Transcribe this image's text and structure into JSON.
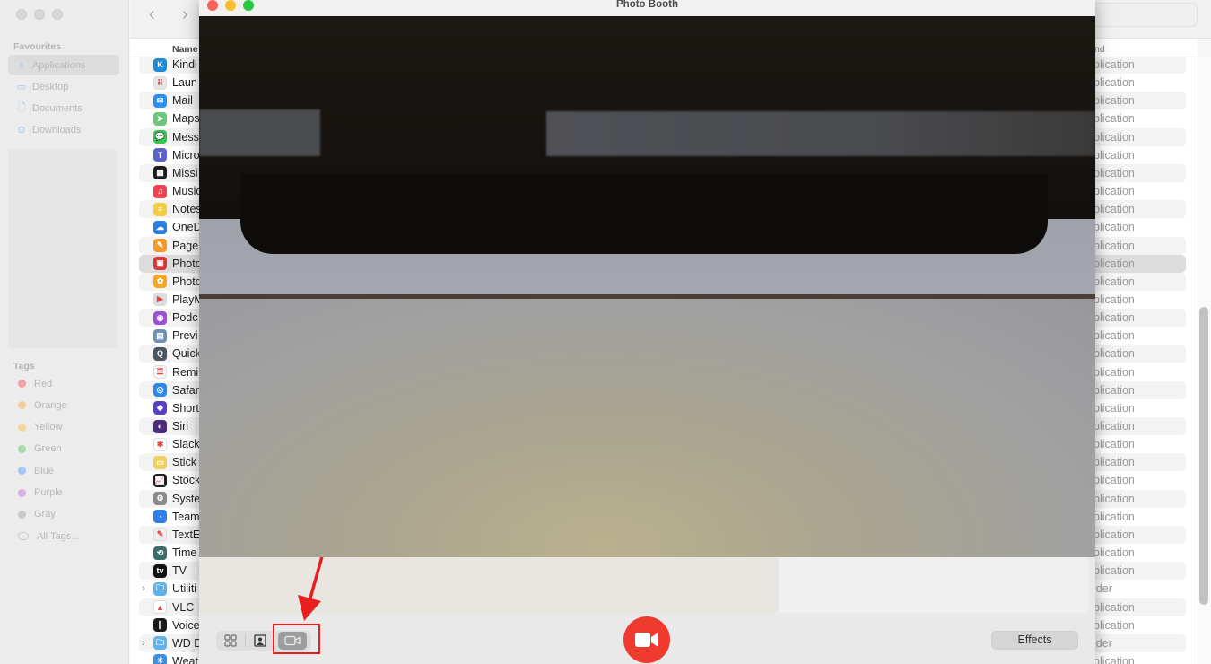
{
  "finder": {
    "sidebar": {
      "favourites_heading": "Favourites",
      "favourites": [
        {
          "label": "Applications",
          "icon": "applications-icon",
          "selected": true
        },
        {
          "label": "Desktop",
          "icon": "desktop-icon",
          "selected": false
        },
        {
          "label": "Documents",
          "icon": "document-icon",
          "selected": false
        },
        {
          "label": "Downloads",
          "icon": "downloads-icon",
          "selected": false
        }
      ],
      "tags_heading": "Tags",
      "tags": [
        {
          "label": "Red",
          "color": "#f2a3a3"
        },
        {
          "label": "Orange",
          "color": "#f2cd9b"
        },
        {
          "label": "Yellow",
          "color": "#f3d89b"
        },
        {
          "label": "Green",
          "color": "#a3dba7"
        },
        {
          "label": "Blue",
          "color": "#a5c6f3"
        },
        {
          "label": "Purple",
          "color": "#d9b0e6"
        },
        {
          "label": "Gray",
          "color": "#c8c8c8"
        },
        {
          "label": "All Tags...",
          "color": ""
        }
      ]
    },
    "toolbar": {
      "back_icon": "chevron-left-icon",
      "forward_icon": "chevron-right-icon"
    },
    "list": {
      "columns": {
        "name": "Name",
        "kind": "nd"
      },
      "rows": [
        {
          "name": "Kindl",
          "kind": "plication",
          "icon_color": "#1f8ad8",
          "glyph": "K"
        },
        {
          "name": "Laun",
          "kind": "plication",
          "icon_color": "#e6e6e6",
          "glyph": "⠿"
        },
        {
          "name": "Mail",
          "kind": "plication",
          "icon_color": "#2d8ef0",
          "glyph": "✉"
        },
        {
          "name": "Maps",
          "kind": "plication",
          "icon_color": "#6cc77a",
          "glyph": "➤"
        },
        {
          "name": "Mess",
          "kind": "plication",
          "icon_color": "#36c44f",
          "glyph": "💬"
        },
        {
          "name": "Micro",
          "kind": "plication",
          "icon_color": "#5b62c9",
          "glyph": "T"
        },
        {
          "name": "Missi",
          "kind": "plication",
          "icon_color": "#1c1c1c",
          "glyph": "▦"
        },
        {
          "name": "Music",
          "kind": "plication",
          "icon_color": "#f0434f",
          "glyph": "♫"
        },
        {
          "name": "Notes",
          "kind": "plication",
          "icon_color": "#f4cd3e",
          "glyph": "≡"
        },
        {
          "name": "OneD",
          "kind": "plication",
          "icon_color": "#2a7ee0",
          "glyph": "☁"
        },
        {
          "name": "Page",
          "kind": "plication",
          "icon_color": "#f39a2b",
          "glyph": "✎"
        },
        {
          "name": "Photo",
          "kind": "plication",
          "icon_color": "#d93636",
          "glyph": "▣",
          "selected": true
        },
        {
          "name": "Photo",
          "kind": "plication",
          "icon_color": "#f5a623",
          "glyph": "✿"
        },
        {
          "name": "PlayM",
          "kind": "plication",
          "icon_color": "#dddddd",
          "glyph": "▶"
        },
        {
          "name": "Podc",
          "kind": "plication",
          "icon_color": "#9b4fd6",
          "glyph": "◉"
        },
        {
          "name": "Previ",
          "kind": "plication",
          "icon_color": "#6e8fb8",
          "glyph": "▤"
        },
        {
          "name": "Quick",
          "kind": "plication",
          "icon_color": "#4a5561",
          "glyph": "Q"
        },
        {
          "name": "Remi",
          "kind": "plication",
          "icon_color": "#f5f5f5",
          "glyph": "☰"
        },
        {
          "name": "Safar",
          "kind": "plication",
          "icon_color": "#2f87e8",
          "glyph": "◎"
        },
        {
          "name": "Short",
          "kind": "plication",
          "icon_color": "#5a3fc4",
          "glyph": "◆"
        },
        {
          "name": "Siri",
          "kind": "plication",
          "icon_color": "#4b2c7a",
          "glyph": "◐"
        },
        {
          "name": "Slack",
          "kind": "plication",
          "icon_color": "#ffffff",
          "glyph": "✱"
        },
        {
          "name": "Stick",
          "kind": "plication",
          "icon_color": "#f0d063",
          "glyph": "▭"
        },
        {
          "name": "Stock",
          "kind": "plication",
          "icon_color": "#1f1f1f",
          "glyph": "📈"
        },
        {
          "name": "Syste",
          "kind": "plication",
          "icon_color": "#8a8a8a",
          "glyph": "⚙"
        },
        {
          "name": "Team",
          "kind": "plication",
          "icon_color": "#2f7fe6",
          "glyph": "◔"
        },
        {
          "name": "TextE",
          "kind": "plication",
          "icon_color": "#eeeeee",
          "glyph": "✎"
        },
        {
          "name": "Time",
          "kind": "plication",
          "icon_color": "#3b6e6a",
          "glyph": "⟲"
        },
        {
          "name": "TV",
          "kind": "plication",
          "icon_color": "#111111",
          "glyph": "tv"
        },
        {
          "name": "Utiliti",
          "kind": "lder",
          "icon_color": "#5fb3ec",
          "glyph": "🗀",
          "folder": true
        },
        {
          "name": "VLC",
          "kind": "plication",
          "icon_color": "#ffffff",
          "glyph": "▲"
        },
        {
          "name": "Voice",
          "kind": "plication",
          "icon_color": "#1a1a1a",
          "glyph": "∥"
        },
        {
          "name": "WD D",
          "kind": "lder",
          "icon_color": "#5fb3ec",
          "glyph": "🗀",
          "folder": true
        },
        {
          "name": "Weat",
          "kind": "plication",
          "icon_color": "#3a8fe0",
          "glyph": "☀"
        }
      ]
    }
  },
  "photobooth": {
    "title": "Photo Booth",
    "view_modes": [
      {
        "name": "grid-view",
        "active": false
      },
      {
        "name": "single-photo-view",
        "active": false
      },
      {
        "name": "video-view",
        "active": true
      }
    ],
    "record_button_icon": "video-camera-icon",
    "effects_label": "Effects",
    "colors": {
      "record": "#ef3a2f",
      "annotation": "#ea1e1e"
    }
  }
}
